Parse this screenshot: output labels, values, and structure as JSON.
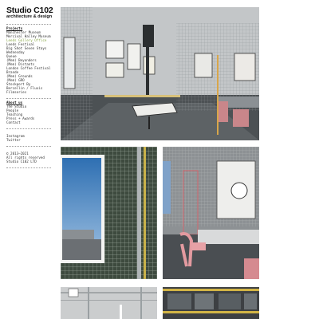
{
  "site": {
    "title": "Studio C102",
    "subtitle": "architecture & design"
  },
  "nav": {
    "projects_heading": "Projects",
    "projects": [
      "Manchester Museum",
      "Mercival Halley Museum",
      "Leeds Gallery Office",
      "Leeds Festival",
      "Big Shot Seven Stays",
      "Wednesday",
      "Queue",
      "(Mem) Beyonders",
      "(Mem) Distants",
      "London Coffee Festival",
      "Brande",
      "(Mem) Grounds",
      "(Mem) GRO",
      "Stockport By",
      "Bercellin / Fluxis",
      "Filmseries"
    ],
    "active_project": "Leeds Gallery Office",
    "about_heading": "About us",
    "about": [
      "The Studio",
      "People",
      "Teaching",
      "Press + Awards",
      "Contact"
    ],
    "social": [
      "Instagram",
      "Twitter"
    ]
  },
  "footer": {
    "copyright": "© 2013–2021",
    "rights": "All rights reserved",
    "credit": "Studio C102 LTD"
  },
  "photos": [
    {
      "name": "gallery-workshop-photo",
      "alt": "Workshop interior with grid mesh walls"
    },
    {
      "name": "mesh-display-photo",
      "alt": "Green grid mesh with framed print"
    },
    {
      "name": "office-desk-photo",
      "alt": "Desk with pink chairs and clock"
    },
    {
      "name": "ceiling-lights-photo",
      "alt": "Ceiling with lights"
    },
    {
      "name": "shelving-photo",
      "alt": "Shelving with yellow rails"
    }
  ]
}
